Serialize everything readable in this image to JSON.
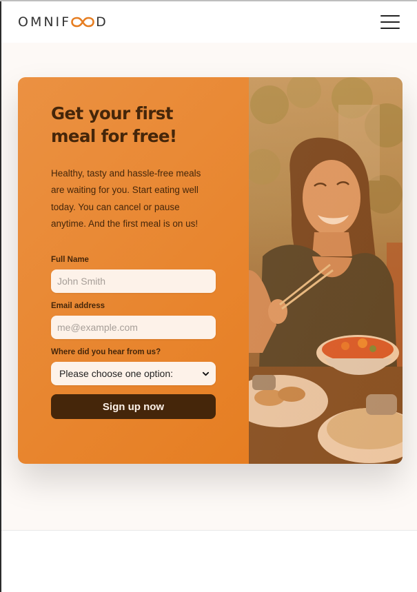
{
  "header": {
    "logo_text_before": "OMNIF",
    "logo_text_after": "D",
    "menu_icon": "menu-icon"
  },
  "cta": {
    "title": "Get your first meal for free!",
    "description": "Healthy, tasty and hassle-free meals are waiting for you. Start eating well today. You can cancel or pause anytime. And the first meal is on us!",
    "form": {
      "full_name_label": "Full Name",
      "full_name_placeholder": "John Smith",
      "email_label": "Email address",
      "email_placeholder": "me@example.com",
      "source_label": "Where did you hear from us?",
      "source_selected": "Please choose one option:",
      "submit_label": "Sign up now"
    }
  },
  "colors": {
    "primary": "#e67e22",
    "dark_brown": "#45260a",
    "input_bg": "#fdf2e9"
  }
}
